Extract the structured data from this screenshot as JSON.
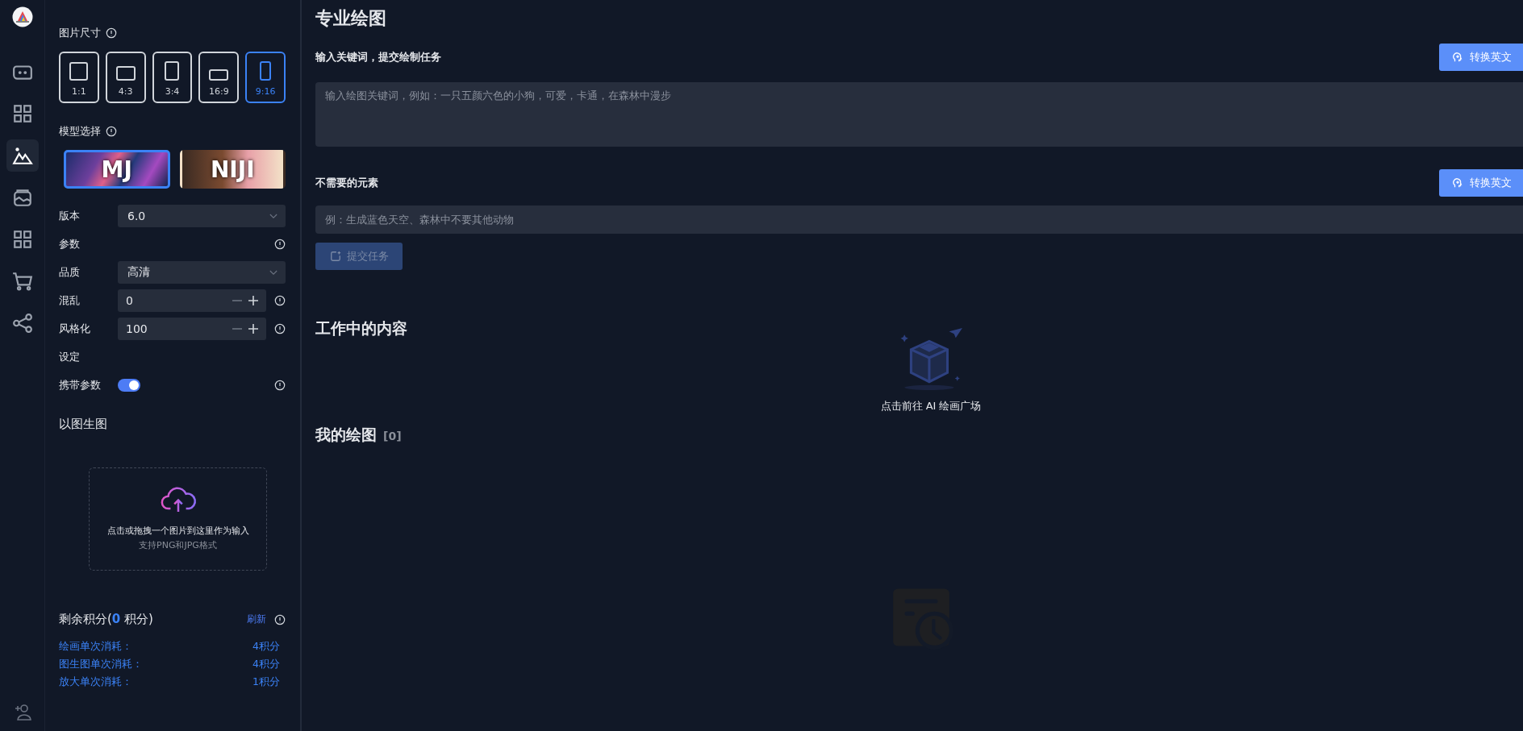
{
  "rail": {
    "items": [
      {
        "kind": "chat",
        "selected": false
      },
      {
        "kind": "grid",
        "selected": false
      },
      {
        "kind": "mountain",
        "selected": true
      },
      {
        "kind": "wallet",
        "selected": false
      },
      {
        "kind": "grid",
        "selected": false
      },
      {
        "kind": "cart",
        "selected": false
      },
      {
        "kind": "share",
        "selected": false
      }
    ]
  },
  "size": {
    "label": "图片尺寸",
    "options": [
      {
        "label": "1:1",
        "kind": "square",
        "selected": false
      },
      {
        "label": "4:3",
        "kind": "landscape",
        "selected": false
      },
      {
        "label": "3:4",
        "kind": "portrait",
        "selected": false
      },
      {
        "label": "16:9",
        "kind": "wide",
        "selected": false
      },
      {
        "label": "9:16",
        "kind": "tall",
        "selected": true
      }
    ]
  },
  "model": {
    "label": "模型选择",
    "options": [
      {
        "label": "MJ",
        "selected": true
      },
      {
        "label": "NIJI",
        "selected": false
      }
    ]
  },
  "fields": [
    {
      "kind": "select",
      "label": "版本",
      "value": "6.0",
      "info": false
    },
    {
      "kind": "heading",
      "label": "参数",
      "info": true
    },
    {
      "kind": "select",
      "label": "品质",
      "value": "高清",
      "info": false
    },
    {
      "kind": "number",
      "label": "混乱",
      "value": "0",
      "info": true
    },
    {
      "kind": "number",
      "label": "风格化",
      "value": "100",
      "info": true
    },
    {
      "kind": "heading",
      "label": "设定",
      "info": false
    },
    {
      "kind": "toggle",
      "label": "携带参数",
      "on": true,
      "info": true
    }
  ],
  "upload": {
    "title": "以图生图",
    "hint": "点击或拖拽一个图片到这里作为输入",
    "formats": "支持PNG和JPG格式"
  },
  "credits": {
    "before": "剩余积分(",
    "amount": "0",
    "after": " 积分)",
    "refresh": "刷新",
    "costs": [
      {
        "label": "绘画单次消耗：",
        "value": "4积分"
      },
      {
        "label": "图生图单次消耗：",
        "value": "4积分"
      },
      {
        "label": "放大单次消耗：",
        "value": "1积分"
      }
    ]
  },
  "main": {
    "title": "专业绘图",
    "prompt": {
      "label": "输入关键词，提交绘制任务",
      "placeholder": "输入绘图关键词，例如：一只五颜六色的小狗，可爱，卡通，在森林中漫步",
      "translate": "转换英文"
    },
    "negative": {
      "label": "不需要的元素",
      "placeholder": "例：生成蓝色天空、森林中不要其他动物",
      "translate": "转换英文"
    },
    "submit": {
      "label": "提交任务",
      "disabled": true
    },
    "working": {
      "title": "工作中的内容",
      "link": "点击前往 AI 绘画广场"
    },
    "mine": {
      "title": "我的绘图",
      "count": "[0]"
    }
  }
}
